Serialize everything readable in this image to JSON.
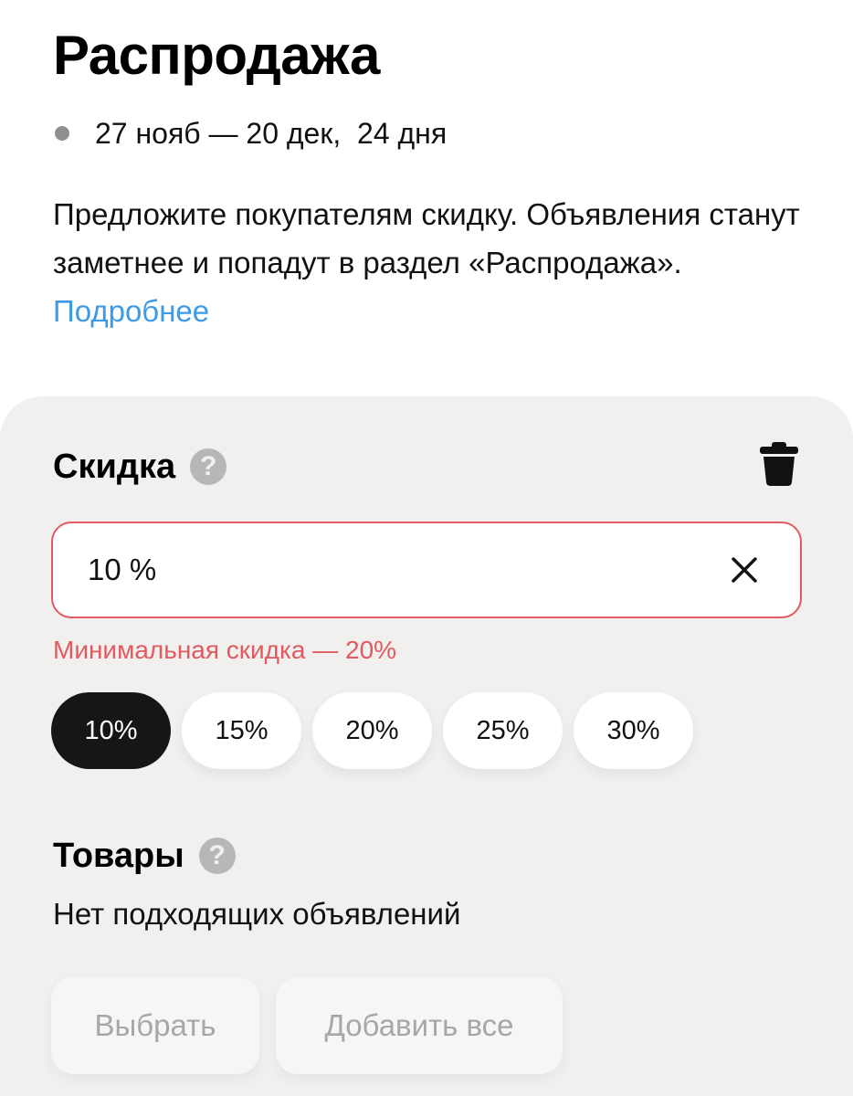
{
  "header": {
    "title": "Распродажа",
    "date_from": "27 нояб",
    "date_sep": " — ",
    "date_to": "20 дек,",
    "duration": "24 дня"
  },
  "description": {
    "text": "Предложите покупателям скидку. Объявления станут заметнее и попадут в раздел «Распродажа».",
    "link": "Подробнее"
  },
  "discount": {
    "title": "Скидка",
    "help_icon": "question-circle-icon",
    "delete_icon": "trash-icon",
    "input_value": "10 %",
    "clear_icon": "close-icon",
    "error": "Минимальная скидка — 20%",
    "error_color": "#e05a5f",
    "options": [
      "10%",
      "15%",
      "20%",
      "25%",
      "30%"
    ],
    "selected": "10%"
  },
  "products": {
    "title": "Товары",
    "help_icon": "question-circle-icon",
    "empty_text": "Нет подходящих объявлений",
    "select_label": "Выбрать",
    "add_all_label": "Добавить все"
  },
  "colors": {
    "link": "#3f9ae6",
    "panel_bg": "#f2f0ef",
    "chip_active_bg": "#161616"
  }
}
